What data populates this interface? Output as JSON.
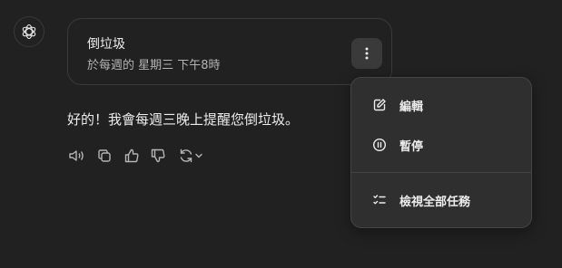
{
  "task": {
    "title": "倒垃圾",
    "schedule": "於每週的 星期三 下午8時",
    "more_icon": "more-vertical-icon"
  },
  "reply": {
    "text": "好的！我會每週三晚上提醒您倒垃圾。"
  },
  "actions": [
    "read-aloud-icon",
    "copy-icon",
    "thumbs-up-icon",
    "thumbs-down-icon",
    "regenerate-icon",
    "chevron-down-icon"
  ],
  "menu": {
    "items": [
      {
        "label": "編輯",
        "icon": "edit-icon"
      },
      {
        "label": "暫停",
        "icon": "pause-icon"
      },
      {
        "label": "檢視全部任務",
        "icon": "task-list-icon"
      }
    ]
  },
  "colors": {
    "background": "#212121",
    "menu_background": "#2f2f2f",
    "text": "#ececec",
    "muted_text": "#b4b4b4"
  }
}
